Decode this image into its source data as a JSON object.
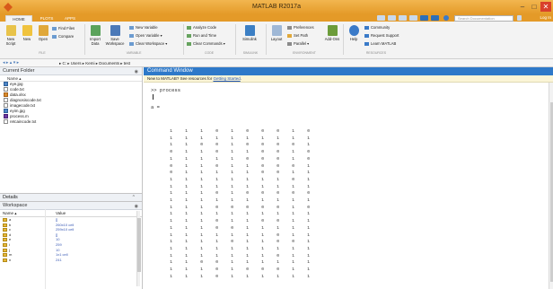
{
  "window": {
    "title": "MATLAB R2017a",
    "minimize": "–",
    "maximize": "□",
    "close": "✕"
  },
  "tabs": [
    "HOME",
    "PLOTS",
    "APPS"
  ],
  "search": {
    "placeholder": "Search Documentation"
  },
  "login_label": "Log In",
  "ribbon": {
    "file": {
      "new_script": "New Script",
      "new": "New",
      "open": "Open",
      "find_files": "Find Files",
      "compare": "Compare",
      "section": "FILE"
    },
    "variable": {
      "import_data": "Import Data",
      "save_workspace": "Save Workspace",
      "new_variable": "New Variable",
      "open_variable": "Open Variable ▾",
      "clear_workspace": "Clear Workspace ▾",
      "section": "VARIABLE"
    },
    "code": {
      "analyze_code": "Analyze Code",
      "run_and_time": "Run and Time",
      "clear_commands": "Clear Commands ▾",
      "section": "CODE"
    },
    "simulink": {
      "simulink": "Simulink",
      "section": "SIMULINK"
    },
    "environment": {
      "layout": "Layout",
      "preferences": "Preferences",
      "set_path": "Set Path",
      "parallel": "Parallel ▾",
      "add_ons": "Add-Ons",
      "section": "ENVIRONMENT"
    },
    "resources": {
      "help": "Help",
      "community": "Community",
      "request_support": "Request Support",
      "learn_matlab": "Learn MATLAB",
      "section": "RESOURCES"
    }
  },
  "address": {
    "crumbs": "▸ C: ▸ Users ▸ Kemi ▸ Documents ▸ test"
  },
  "current_folder": {
    "title": "Current Folder",
    "column": "Name ▴",
    "files": [
      {
        "name": "eye.jpg",
        "type": "img"
      },
      {
        "name": "code.txt",
        "type": "txt"
      },
      {
        "name": "data.xlsx",
        "type": "mat"
      },
      {
        "name": "diagnosiscode.txt",
        "type": "txt"
      },
      {
        "name": "imagecode.txt",
        "type": "txt"
      },
      {
        "name": "eyim.jpg",
        "type": "img"
      },
      {
        "name": "process.m",
        "type": "m"
      },
      {
        "name": "retcaincode.txt",
        "type": "txt"
      }
    ]
  },
  "details": {
    "title": "Details"
  },
  "workspace": {
    "title": "Workspace",
    "col_name": "Name ▴",
    "col_value": "Value",
    "vars": [
      {
        "name": "a",
        "value": "[]"
      },
      {
        "name": "b",
        "value": "260x10 cell"
      },
      {
        "name": "c",
        "value": "259x10 cell"
      },
      {
        "name": "d",
        "value": "[]"
      },
      {
        "name": "e",
        "value": "10"
      },
      {
        "name": "i",
        "value": "259"
      },
      {
        "name": "j",
        "value": "10"
      },
      {
        "name": "m",
        "value": "1x1 cell"
      },
      {
        "name": "n",
        "value": "241"
      }
    ]
  },
  "command_window": {
    "title": "Command Window",
    "notice_text": "New to MATLAB? See resources for ",
    "notice_link": "Getting Started",
    "notice_end": ".",
    "prompt": ">> process",
    "assign": "a ="
  },
  "matrix": [
    [
      1,
      1,
      1,
      0,
      1,
      0,
      0,
      0,
      1,
      0
    ],
    [
      1,
      1,
      1,
      1,
      1,
      1,
      1,
      1,
      1,
      1
    ],
    [
      1,
      1,
      0,
      0,
      1,
      0,
      0,
      0,
      0,
      1
    ],
    [
      0,
      1,
      1,
      0,
      1,
      1,
      0,
      0,
      1,
      0
    ],
    [
      1,
      1,
      1,
      1,
      1,
      0,
      0,
      0,
      1,
      0
    ],
    [
      0,
      1,
      1,
      0,
      1,
      1,
      0,
      0,
      0,
      1
    ],
    [
      0,
      1,
      1,
      1,
      1,
      1,
      0,
      0,
      1,
      1
    ],
    [
      1,
      1,
      1,
      1,
      1,
      1,
      1,
      1,
      0,
      1
    ],
    [
      1,
      1,
      1,
      1,
      1,
      1,
      1,
      1,
      1,
      1
    ],
    [
      1,
      1,
      1,
      0,
      1,
      0,
      0,
      0,
      0,
      0
    ],
    [
      1,
      1,
      1,
      1,
      1,
      1,
      1,
      1,
      1,
      1
    ],
    [
      1,
      1,
      1,
      0,
      0,
      0,
      0,
      0,
      1,
      0
    ],
    [
      1,
      1,
      1,
      1,
      1,
      1,
      1,
      1,
      1,
      1
    ],
    [
      1,
      1,
      1,
      0,
      1,
      1,
      0,
      0,
      1,
      1
    ],
    [
      1,
      1,
      1,
      0,
      0,
      1,
      1,
      1,
      1,
      1
    ],
    [
      1,
      1,
      1,
      1,
      1,
      1,
      1,
      0,
      1,
      1
    ],
    [
      1,
      1,
      1,
      1,
      0,
      1,
      1,
      0,
      0,
      1
    ],
    [
      1,
      1,
      1,
      1,
      1,
      1,
      1,
      1,
      1,
      1
    ],
    [
      1,
      1,
      1,
      1,
      1,
      1,
      1,
      0,
      1,
      1
    ],
    [
      1,
      1,
      0,
      0,
      1,
      1,
      1,
      1,
      1,
      1
    ],
    [
      1,
      1,
      1,
      0,
      1,
      0,
      0,
      0,
      1,
      1
    ],
    [
      1,
      1,
      1,
      0,
      1,
      1,
      1,
      1,
      1,
      1
    ]
  ],
  "colors": {
    "title_bar": "#e49a28",
    "command_window_title": "#2e79c9",
    "notice_bg": "#fbf5d7",
    "link": "#1f54b3"
  }
}
